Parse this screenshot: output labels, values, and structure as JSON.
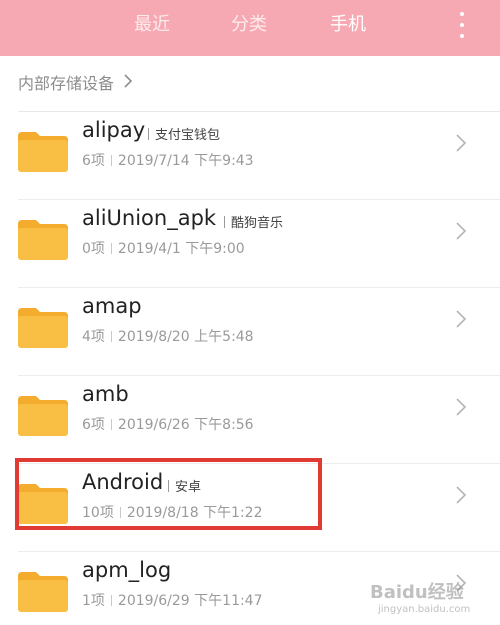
{
  "tabs": [
    {
      "label": "最近",
      "active": false
    },
    {
      "label": "分类",
      "active": false
    },
    {
      "label": "手机",
      "active": true
    }
  ],
  "header": {
    "menu_icon": "more-vertical-icon",
    "background": "#f7a9b3"
  },
  "breadcrumb": {
    "label": "内部存储设备",
    "icon": "chevron-right-icon"
  },
  "folders": [
    {
      "name": "alipay",
      "tag": "支付宝钱包",
      "count": "6项",
      "date": "2019/7/14 下午9:43"
    },
    {
      "name": "aliUnion_apk",
      "tag": "酷狗音乐",
      "count": "0项",
      "date": "2019/4/1 下午9:00"
    },
    {
      "name": "amap",
      "tag": "",
      "count": "4项",
      "date": "2019/8/20 上午5:48"
    },
    {
      "name": "amb",
      "tag": "",
      "count": "6项",
      "date": "2019/6/26 下午8:56"
    },
    {
      "name": "Android",
      "tag": "安卓",
      "count": "10项",
      "date": "2019/8/18 下午1:22",
      "highlighted": true
    },
    {
      "name": "apm_log",
      "tag": "",
      "count": "1项",
      "date": "2019/6/29 下午11:47"
    }
  ],
  "colors": {
    "folder": "#f9bf45",
    "folder_tab": "#f4ac2e",
    "highlight": "#e03a32"
  },
  "watermark": {
    "main": "Baidu经验",
    "sub": "jingyan.baidu.com"
  }
}
